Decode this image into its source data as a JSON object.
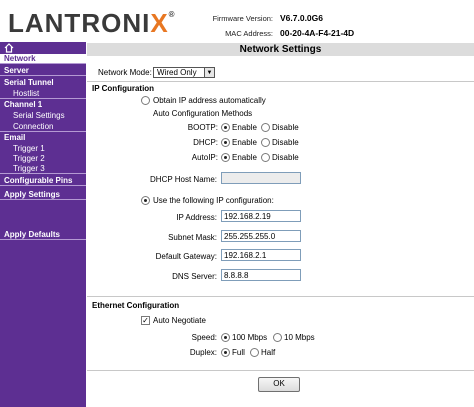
{
  "header": {
    "logo": "LANTRONIX",
    "firmware_label": "Firmware Version:",
    "firmware_value": "V6.7.0.0G6",
    "mac_label": "MAC Address:",
    "mac_value": "00-20-4A-F4-21-4D"
  },
  "sidebar": {
    "home_icon": "home-icon",
    "items": [
      {
        "label": "Network"
      },
      {
        "label": "Server"
      },
      {
        "label": "Serial Tunnel"
      },
      {
        "label": "Hostlist"
      },
      {
        "label": "Channel 1"
      },
      {
        "label": "Serial Settings"
      },
      {
        "label": "Connection"
      },
      {
        "label": "Email"
      },
      {
        "label": "Trigger 1"
      },
      {
        "label": "Trigger 2"
      },
      {
        "label": "Trigger 3"
      },
      {
        "label": "Configurable Pins"
      },
      {
        "label": "Apply Settings"
      },
      {
        "label": "Apply Defaults"
      }
    ]
  },
  "page": {
    "title": "Network Settings",
    "network_mode_label": "Network Mode:",
    "network_mode_value": "Wired Only",
    "ip_config_heading": "IP Configuration",
    "obtain_auto_label": "Obtain IP address automatically",
    "auto_methods_label": "Auto Configuration Methods",
    "bootp_label": "BOOTP:",
    "dhcp_label": "DHCP:",
    "autoip_label": "AutoIP:",
    "enable_label": "Enable",
    "disable_label": "Disable",
    "dhcp_host_label": "DHCP Host Name:",
    "dhcp_host_value": "",
    "use_following_label": "Use the following IP configuration:",
    "ip_address_label": "IP Address:",
    "ip_address_value": "192.168.2.19",
    "subnet_label": "Subnet Mask:",
    "subnet_value": "255.255.255.0",
    "gateway_label": "Default Gateway:",
    "gateway_value": "192.168.2.1",
    "dns_label": "DNS Server:",
    "dns_value": "8.8.8.8",
    "ethernet_heading": "Ethernet Configuration",
    "auto_negotiate_label": "Auto Negotiate",
    "speed_label": "Speed:",
    "speed_100": "100 Mbps",
    "speed_10": "10 Mbps",
    "duplex_label": "Duplex:",
    "duplex_full": "Full",
    "duplex_half": "Half",
    "ok_label": "OK"
  },
  "colors": {
    "sidebar_bg": "#5d2f92",
    "logo_accent": "#e87722",
    "title_bar": "#dcdcdc"
  }
}
